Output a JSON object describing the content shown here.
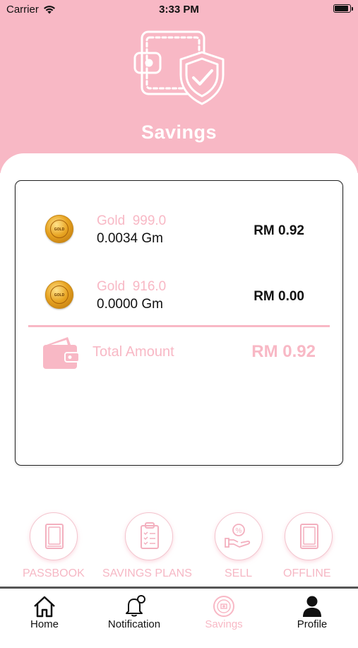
{
  "status_bar": {
    "carrier": "Carrier",
    "time": "3:33 PM"
  },
  "header": {
    "title": "Savings",
    "icon": "wallet-shield-icon"
  },
  "holdings": [
    {
      "name": "Gold  999.0",
      "weight": "0.0034 Gm",
      "value": "RM 0.92",
      "coin_text": "GOLD"
    },
    {
      "name": "Gold  916.0",
      "weight": "0.0000 Gm",
      "value": "RM 0.00",
      "coin_text": "GOLD"
    }
  ],
  "total": {
    "label": "Total Amount",
    "value": "RM 0.92"
  },
  "actions": [
    {
      "label": "PASSBOOK",
      "icon": "book-icon"
    },
    {
      "label": "SAVINGS PLANS",
      "icon": "clipboard-icon"
    },
    {
      "label": "SELL",
      "icon": "sell-hand-coin-icon"
    },
    {
      "label": "OFFLINE",
      "icon": "book-icon"
    }
  ],
  "tabs": [
    {
      "label": "Home",
      "icon": "home-icon",
      "active": false
    },
    {
      "label": "Notification",
      "icon": "bell-icon",
      "active": false
    },
    {
      "label": "Savings",
      "icon": "savings-coin-icon",
      "active": true
    },
    {
      "label": "Profile",
      "icon": "user-icon",
      "active": false
    }
  ],
  "colors": {
    "accent": "#f8b8c5",
    "text": "#111111",
    "card_border": "#222222"
  }
}
